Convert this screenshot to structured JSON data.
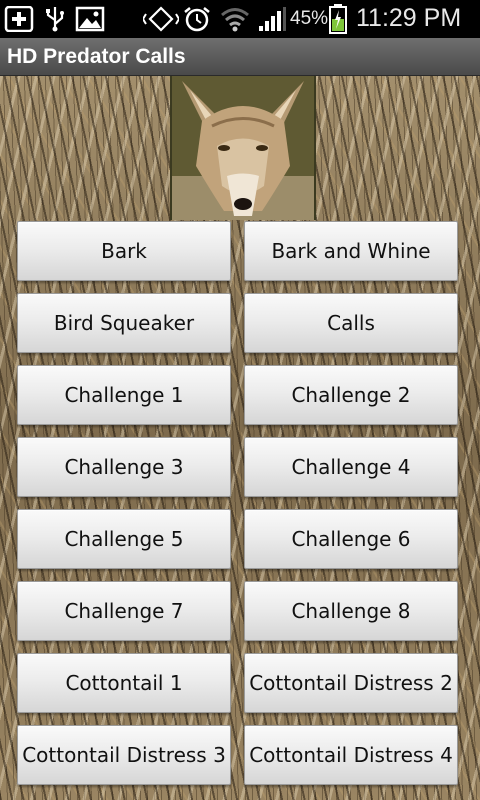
{
  "status_bar": {
    "battery_percent": "45%",
    "time": "11:29 PM",
    "icons": [
      "add-icon",
      "usb-icon",
      "picture-icon",
      "vibrate-icon",
      "alarm-icon",
      "wifi-icon",
      "signal-icon",
      "battery-icon"
    ]
  },
  "app": {
    "title": "HD Predator Calls"
  },
  "header_image": {
    "subject": "coyote-photo"
  },
  "buttons": [
    "Bark",
    "Bark and Whine",
    "Bird Squeaker",
    "Calls",
    "Challenge 1",
    "Challenge 2",
    "Challenge 3",
    "Challenge 4",
    "Challenge 5",
    "Challenge 6",
    "Challenge 7",
    "Challenge 8",
    "Cottontail 1",
    "Cottontail Distress  2",
    "Cottontail Distress 3",
    "Cottontail Distress 4"
  ]
}
